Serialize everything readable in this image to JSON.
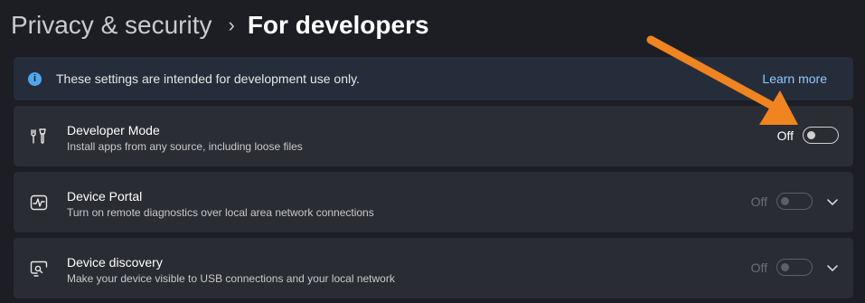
{
  "breadcrumb": {
    "parent": "Privacy & security",
    "separator": "›",
    "current": "For developers"
  },
  "info_bar": {
    "icon": "info-icon",
    "text": "These settings are intended for development use only.",
    "link": "Learn more"
  },
  "settings": [
    {
      "title": "Developer Mode",
      "description": "Install apps from any source, including loose files",
      "state": "Off",
      "icon": "developer-tools-icon"
    },
    {
      "title": "Device Portal",
      "description": "Turn on remote diagnostics over local area network connections",
      "state": "Off",
      "icon": "heartbeat-monitor-icon"
    },
    {
      "title": "Device discovery",
      "description": "Make your device visible to USB connections and your local network",
      "state": "Off",
      "icon": "device-search-icon"
    }
  ],
  "colors": {
    "background": "#1c1e24",
    "card": "#2a2c33",
    "accent_link": "#8fc8ff",
    "info_icon": "#4ea8ec",
    "annotation_arrow": "#f08420"
  }
}
